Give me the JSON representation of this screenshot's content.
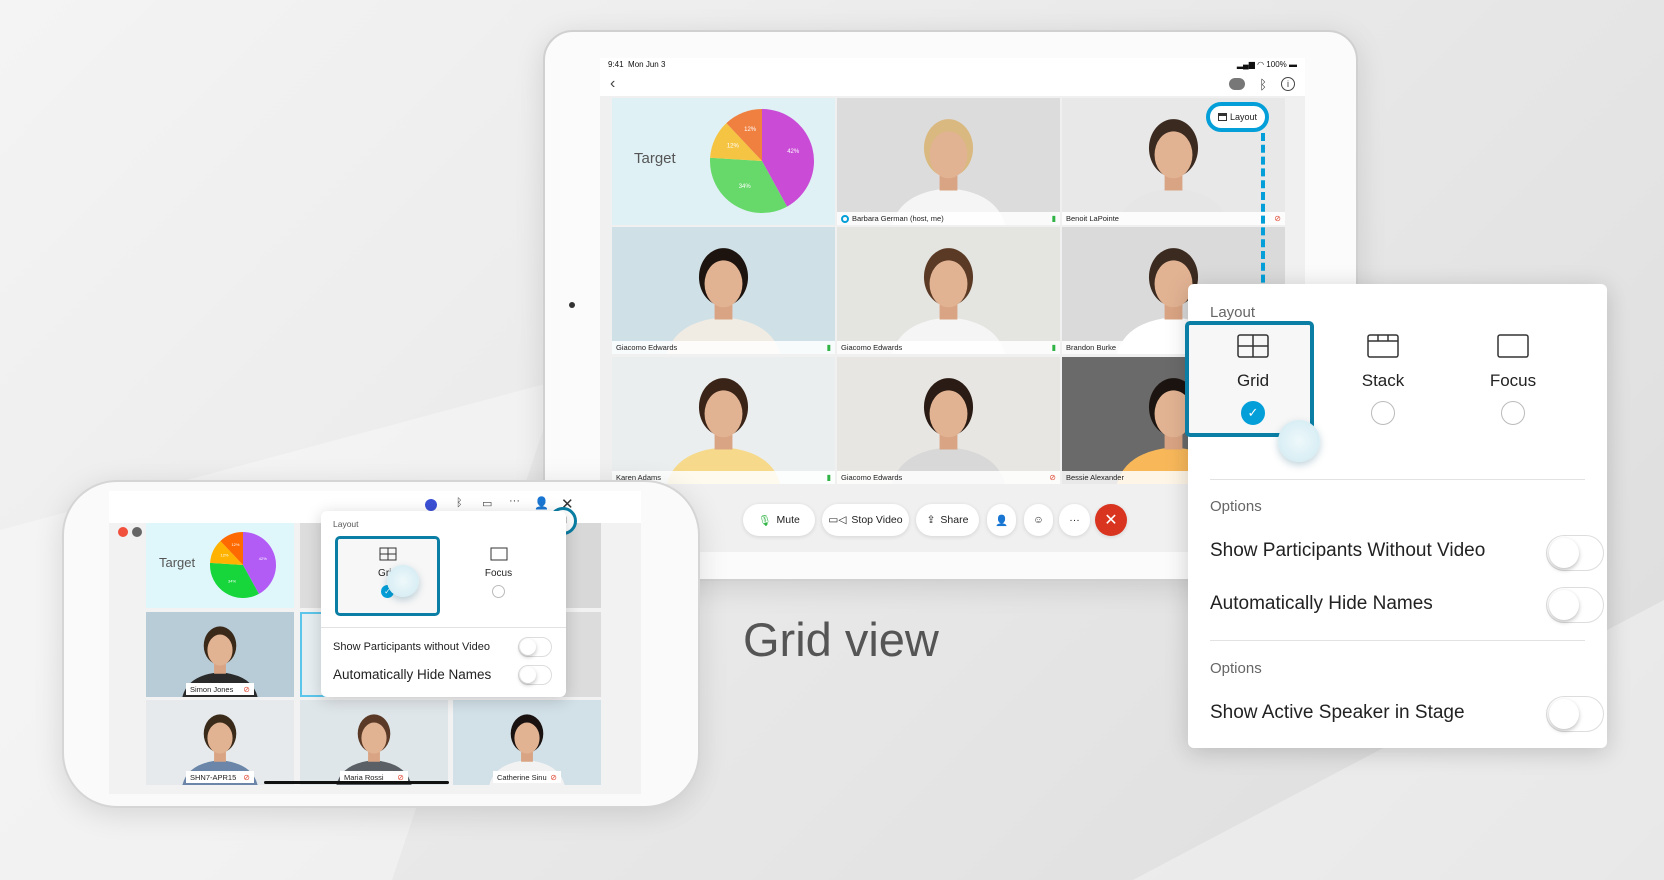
{
  "ipad": {
    "status": {
      "time": "9:41",
      "date": "Mon Jun 3",
      "battery": "100%"
    },
    "nav": {
      "back_icon": "chevron-left-icon",
      "icons": [
        "bot-icon",
        "bluetooth-icon",
        "info-icon"
      ]
    },
    "layout_button": {
      "label": "Layout",
      "icon": "layout-icon"
    },
    "share": {
      "title": "Target",
      "pie": [
        {
          "label": "42%",
          "value": 42,
          "color": "#c94bd6"
        },
        {
          "label": "34%",
          "value": 34,
          "color": "#67d96a"
        },
        {
          "label": "12%",
          "value": 12,
          "color": "#f6c443"
        },
        {
          "label": "12%",
          "value": 12,
          "color": "#f08040"
        }
      ]
    },
    "participants": [
      {
        "name": "Barbara German (host, me)",
        "mic": "unmuted",
        "host_icon": true,
        "bg": "#dcdcdc",
        "hair": "#d9b980",
        "shirt": "#f5f5f5"
      },
      {
        "name": "Benoit LaPointe",
        "mic": "muted",
        "bg": "#e8e8e8",
        "hair": "#3b2a20",
        "shirt": "#e6e6e6"
      },
      {
        "name": "Giacomo Edwards",
        "mic": "unmuted",
        "bg": "#cfe0e6",
        "hair": "#1d1410",
        "shirt": "#f0ece4"
      },
      {
        "name": "Giacomo Edwards",
        "mic": "unmuted",
        "bg": "#e4e4e0",
        "hair": "#5a3a25",
        "shirt": "#f5f5f5"
      },
      {
        "name": "Brandon Burke",
        "mic": "none",
        "bg": "#dadada",
        "hair": "#3a2a20",
        "shirt": "#ffffff"
      },
      {
        "name": "Karen Adams",
        "mic": "unmuted",
        "bg": "#eaeeee",
        "hair": "#3a2418",
        "shirt": "#f6d98a"
      },
      {
        "name": "Giacomo Edwards",
        "mic": "muted",
        "bg": "#e8e6e2",
        "hair": "#2a1c14",
        "shirt": "#d8d8d8"
      },
      {
        "name": "Bessie Alexander",
        "mic": "none",
        "bg": "#6a6a6a",
        "hair": "#1c1410",
        "shirt": "#f8b85a"
      }
    ],
    "toolbar": {
      "mute": "Mute",
      "stop_video": "Stop Video",
      "share": "Share",
      "participants_icon": "participants-icon",
      "reactions_icon": "emoji-icon",
      "more": "···",
      "end_icon": "close-icon"
    }
  },
  "layout_popover": {
    "section_layout": "Layout",
    "options": [
      {
        "label": "Grid",
        "selected": true,
        "icon": "grid-icon"
      },
      {
        "label": "Stack",
        "selected": false,
        "icon": "stack-icon"
      },
      {
        "label": "Focus",
        "selected": false,
        "icon": "focus-icon"
      }
    ],
    "section_options_1": "Options",
    "show_without_video": {
      "label": "Show Participants Without Video",
      "on": false
    },
    "auto_hide_names": {
      "label": "Automatically Hide Names",
      "on": false
    },
    "section_options_2": "Options",
    "active_speaker_stage": {
      "label": "Show Active Speaker in Stage",
      "on": false
    }
  },
  "caption": "Grid view",
  "phone": {
    "share_title": "Target",
    "pie": [
      {
        "label": "42%",
        "value": 42,
        "color": "#b35cf5"
      },
      {
        "label": "34%",
        "value": 34,
        "color": "#16d63c"
      },
      {
        "label": "12%",
        "value": 12,
        "color": "#ffb300"
      },
      {
        "label": "12%",
        "value": 12,
        "color": "#ff6a00"
      }
    ],
    "participants": [
      {
        "name": "Simon Jones",
        "mic": "muted",
        "bg": "#b8ccd8",
        "hair": "#3a2818",
        "shirt": "#2a2a2a"
      },
      {
        "name": "SHN7-APR15",
        "mic": "muted",
        "bg": "#e6eaec",
        "hair": "#3a2a1a",
        "shirt": "#6b86a8"
      },
      {
        "name": "Maria Rossi",
        "mic": "muted",
        "bg": "#dfe6ea",
        "hair": "#5a3a26",
        "shirt": "#5a6066"
      },
      {
        "name": "Catherine Sinu",
        "mic": "muted",
        "bg": "#d2e0e8",
        "hair": "#1a1210",
        "shirt": "#f2f2f2"
      }
    ],
    "popover": {
      "section_layout": "Layout",
      "options": [
        {
          "label": "Grid",
          "selected": true
        },
        {
          "label": "Focus",
          "selected": false
        }
      ],
      "show_without_video": {
        "label": "Show Participants without Video",
        "on": false
      },
      "auto_hide_names": {
        "label": "Automatically Hide Names",
        "on": false
      }
    }
  }
}
